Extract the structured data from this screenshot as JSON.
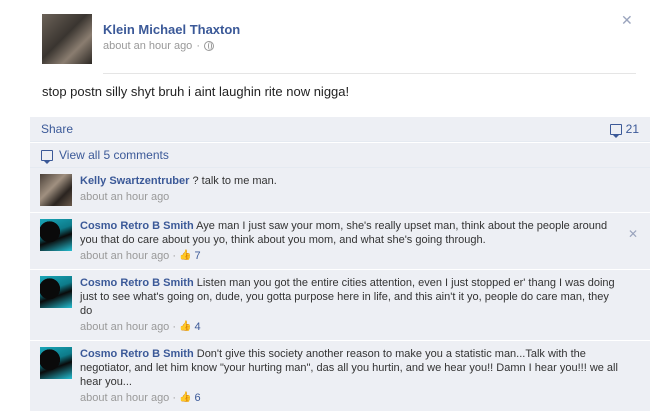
{
  "post": {
    "author": "Klein Michael Thaxton",
    "time": "about an hour ago",
    "separator": "·",
    "text": "stop postn silly shyt bruh i aint laughin rite now nigga!"
  },
  "actions": {
    "share_label": "Share",
    "comment_count": "21",
    "view_all_label": "View all 5 comments"
  },
  "comments": [
    {
      "name": "Kelly Swartzentruber",
      "text": "? talk to me man.",
      "time": "about an hour ago",
      "likes": ""
    },
    {
      "name": "Cosmo Retro B Smith",
      "text": "Aye man I just saw your mom, she's really upset man, think about the people around you that do care about you yo, think about you mom, and what she's going through.",
      "time": "about an hour ago",
      "likes": "7"
    },
    {
      "name": "Cosmo Retro B Smith",
      "text": "Listen man you got the entire cities attention, even I just stopped er' thang I was doing just to see what's going on, dude, you gotta purpose here in life, and this ain't it yo, people do care man, they do",
      "time": "about an hour ago",
      "likes": "4"
    },
    {
      "name": "Cosmo Retro B Smith",
      "text": "Don't give this society another reason to make you a statistic man...Talk with the negotiator, and let him know \"your hurting man\", das all you hurtin, and we hear you!! Damn I hear you!!! we all hear you...",
      "time": "about an hour ago",
      "likes": "6"
    }
  ],
  "colors": {
    "link": "#3b5998",
    "ufi_bg": "#edeff4",
    "meta": "#999999"
  },
  "icons": [
    "close-icon",
    "globe-icon",
    "comment-icon",
    "like-icon"
  ]
}
